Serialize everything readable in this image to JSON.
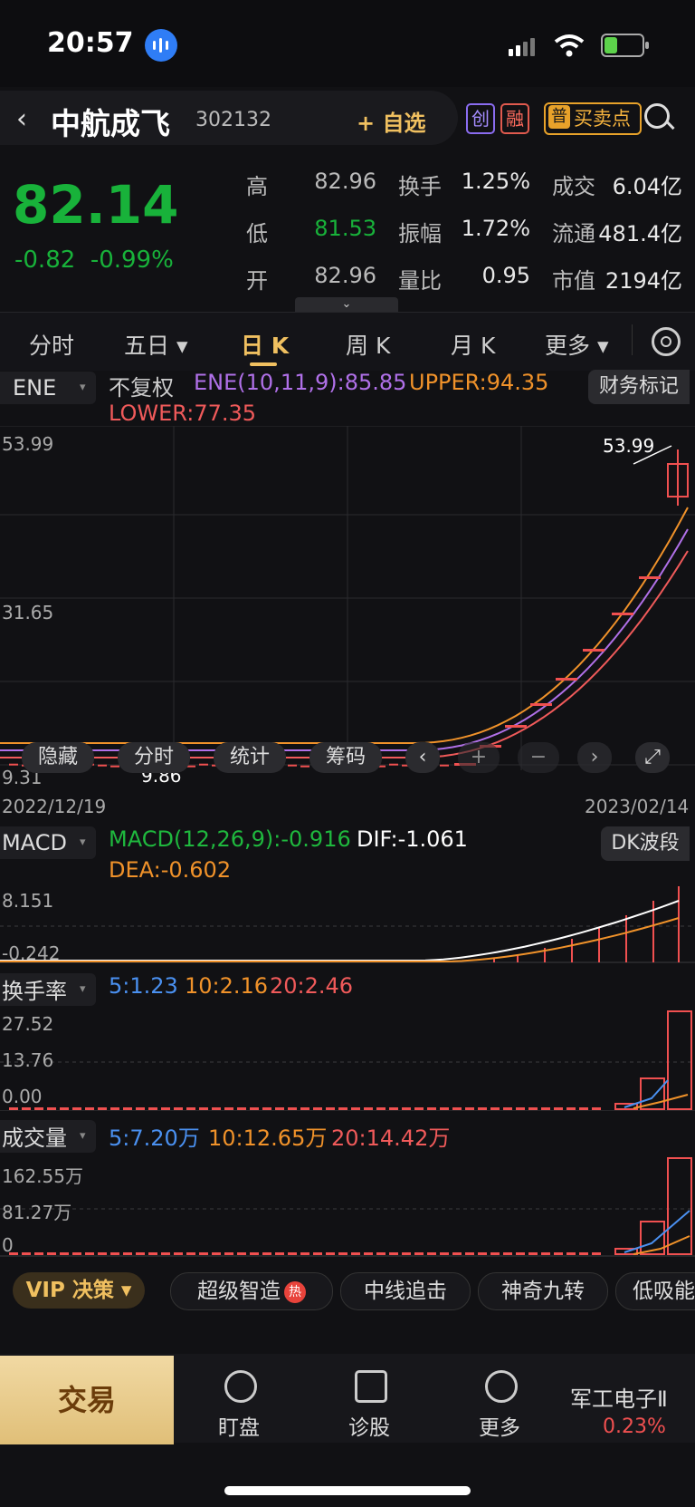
{
  "status": {
    "time": "20:57"
  },
  "header": {
    "back": "‹",
    "name": "中航成飞",
    "code": "302132",
    "add_watch": "+ 自选",
    "tag1": "创",
    "tag2": "融",
    "pu": "普",
    "buysell": "买卖点",
    "colors": {
      "green": "#18b23a",
      "red": "#f05050",
      "gold": "#f0c060"
    }
  },
  "quote": {
    "price": "82.14",
    "change": "-0.82",
    "change_pct": "-0.99%",
    "high_label": "高",
    "high": "82.96",
    "low_label": "低",
    "low": "81.53",
    "open_label": "开",
    "open": "82.96",
    "turnover_label": "换手",
    "turnover": "1.25%",
    "amplitude_label": "振幅",
    "amplitude": "1.72%",
    "volratio_label": "量比",
    "volratio": "0.95",
    "deal_label": "成交",
    "deal": "6.04亿",
    "float_label": "流通",
    "float": "481.4亿",
    "mcap_label": "市值",
    "mcap": "2194亿",
    "expand": "⌄"
  },
  "tabs": [
    "分时",
    "五日 ▾",
    "日 K",
    "周 K",
    "月 K",
    "更多 ▾"
  ],
  "ene": {
    "selector": "ENE",
    "fq": "不复权",
    "ene": "ENE(10,11,9):85.85",
    "upper": "UPPER:94.35",
    "lower": "LOWER:77.35",
    "finance_btn": "财务标记",
    "y_top": "53.99",
    "y_mid": "31.65",
    "y_low": "9.31",
    "peak_label": "53.99",
    "low_label": "9.86",
    "date_start": "2022/12/19",
    "date_end": "2023/02/14",
    "pills": [
      "隐藏",
      "分时",
      "统计",
      "筹码"
    ]
  },
  "macd": {
    "selector": "MACD",
    "macd": "MACD(12,26,9):-0.916",
    "dif": "DIF:-1.061",
    "dea": "DEA:-0.602",
    "dk_btn": "DK波段",
    "y_top": "8.151",
    "y_low": "-0.242"
  },
  "turnover_rate": {
    "selector": "换手率",
    "ma5": "5:1.23",
    "ma10": "10:2.16",
    "ma20": "20:2.46",
    "y_top": "27.52",
    "y_mid": "13.76",
    "y_low": "0.00"
  },
  "volume": {
    "selector": "成交量",
    "ma5": "5:7.20万",
    "ma10": "10:12.65万",
    "ma20": "20:14.42万",
    "y_top": "162.55万",
    "y_mid": "81.27万",
    "y_low": "0"
  },
  "strategy": {
    "vip": "VIP 决策 ▾",
    "hot": "热",
    "chips": [
      "超级智造",
      "中线追击",
      "神奇九转",
      "低吸能"
    ]
  },
  "nav": {
    "trade": "交易",
    "items": [
      "盯盘",
      "诊股",
      "更多"
    ],
    "sector": "军工电子Ⅱ",
    "sector_chg": "0.23%"
  }
}
